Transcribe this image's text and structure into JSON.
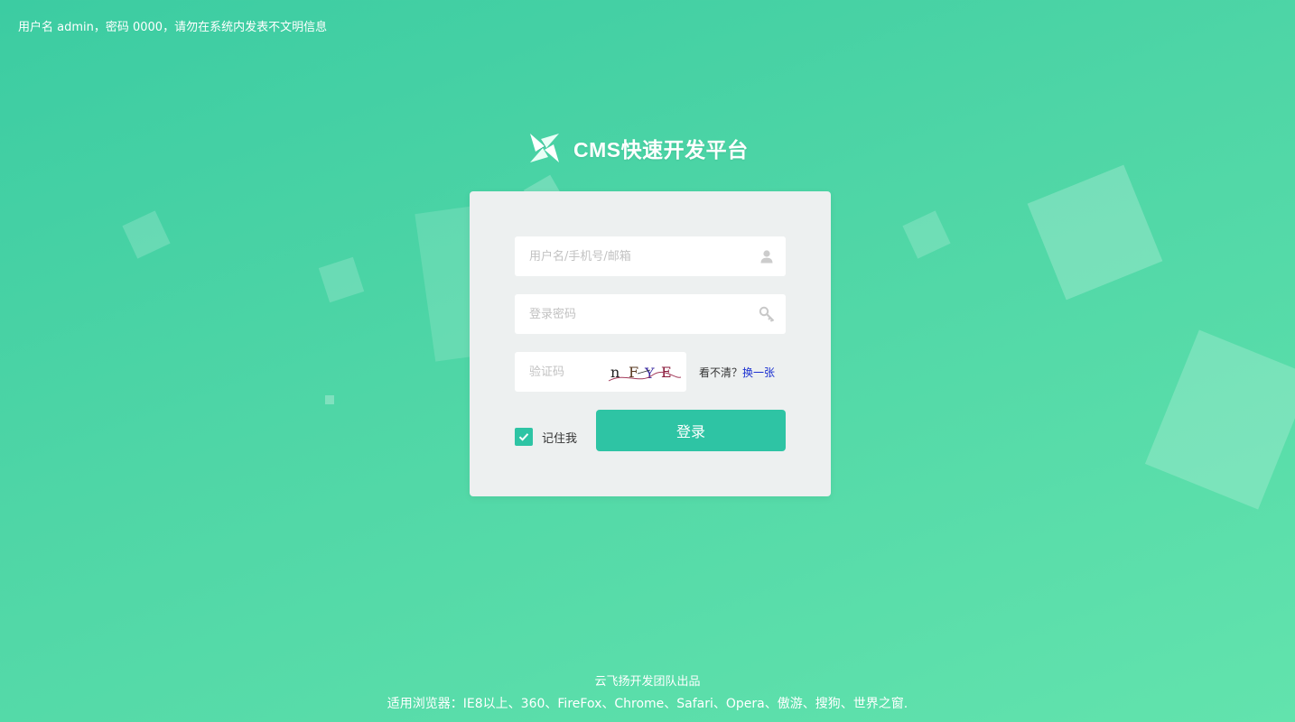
{
  "notice": "用户名 admin，密码 0000，请勿在系统内发表不文明信息",
  "brand": {
    "logo_icon": "pinwheel-logo-icon",
    "title": "CMS快速开发平台"
  },
  "login_form": {
    "username": {
      "placeholder": "用户名/手机号/邮箱",
      "value": "",
      "icon": "user-icon"
    },
    "password": {
      "placeholder": "登录密码",
      "value": "",
      "icon": "key-icon"
    },
    "captcha": {
      "placeholder": "验证码",
      "value": "",
      "image_text": "nFYE",
      "hint_label": "看不清？",
      "refresh_label": "换一张"
    },
    "remember": {
      "label": "记住我",
      "checked": true
    },
    "submit_label": "登录"
  },
  "footer": {
    "credit": "云飞扬开发团队出品",
    "browsers": "适用浏览器：IE8以上、360、FireFox、Chrome、Safari、Opera、傲游、搜狗、世界之窗."
  },
  "colors": {
    "background_start": "#3ccca2",
    "background_end": "#62e3ad",
    "accent": "#2ec4a4",
    "panel": "#edf0f0",
    "link": "#1a2fd0"
  }
}
